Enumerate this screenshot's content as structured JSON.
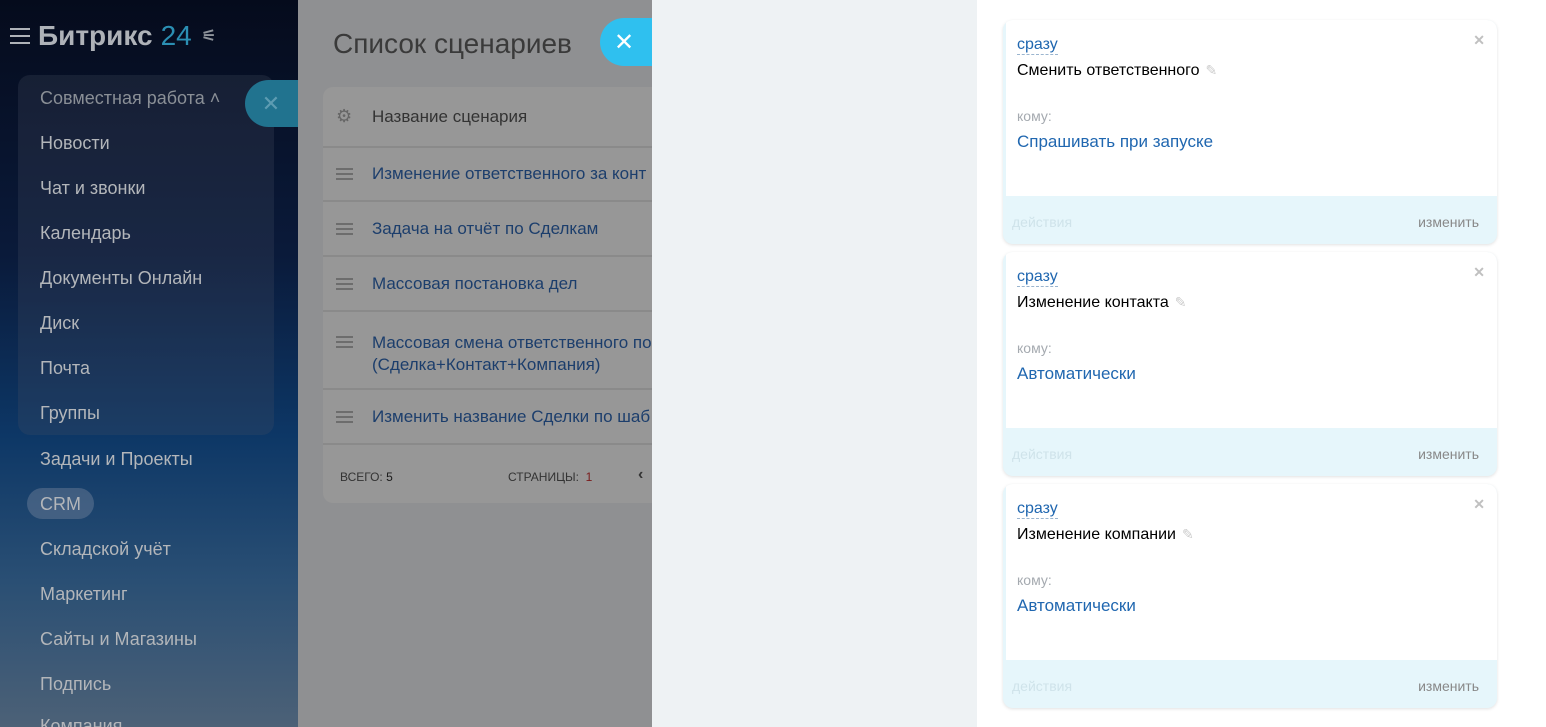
{
  "sidebar": {
    "logo_main": "Битрикс",
    "logo_num": "24",
    "group_title": "Совместная работа",
    "items": [
      "Новости",
      "Чат и звонки",
      "Календарь",
      "Документы Онлайн",
      "Диск",
      "Почта",
      "Группы",
      "Задачи и Проекты",
      "CRM",
      "Складской учёт",
      "Маркетинг",
      "Сайты и Магазины",
      "Подпись",
      "Компания"
    ]
  },
  "panel": {
    "title": "Список сценариев",
    "header": "Название сценария",
    "rows": [
      "Изменение ответственного за конт",
      "Задача на отчёт по Сделкам",
      "Массовая постановка дел",
      "Массовая смена ответственного по",
      "(Сделка+Контакт+Компания)",
      "Изменить название Сделки по шаб"
    ],
    "total_label": "ВСЕГО:",
    "total": "5",
    "pages_label": "СТРАНИЦЫ:",
    "page": "1"
  },
  "cards": [
    {
      "when": "сразу",
      "action": "Сменить ответственного",
      "to_label": "кому:",
      "to": "Спрашивать при запуске",
      "left": "действия",
      "right": "изменить"
    },
    {
      "when": "сразу",
      "action": "Изменение контакта",
      "to_label": "кому:",
      "to": "Автоматически",
      "left": "действия",
      "right": "изменить"
    },
    {
      "when": "сразу",
      "action": "Изменение компании",
      "to_label": "кому:",
      "to": "Автоматически",
      "left": "действия",
      "right": "изменить"
    }
  ]
}
